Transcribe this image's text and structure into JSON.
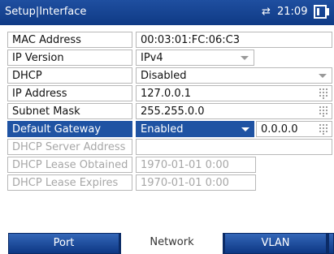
{
  "titlebar": {
    "title": "Setup|Interface",
    "network_icon": "network-arrows-icon",
    "time": "21:09",
    "battery_icon": "battery-icon"
  },
  "form": {
    "mac": {
      "label": "MAC Address",
      "value": "00:03:01:FC:06:C3"
    },
    "ipversion": {
      "label": "IP Version",
      "value": "IPv4"
    },
    "dhcp": {
      "label": "DHCP",
      "value": "Disabled"
    },
    "ip": {
      "label": "IP Address",
      "value": "127.0.0.1"
    },
    "subnet": {
      "label": "Subnet Mask",
      "value": "255.255.0.0"
    },
    "gateway": {
      "label": "Default Gateway",
      "value": "Enabled",
      "address": "0.0.0.0"
    },
    "dhcp_server": {
      "label": "DHCP Server Address",
      "value": ""
    },
    "lease_obtained": {
      "label": "DHCP Lease Obtained",
      "value": "1970-01-01 0:00"
    },
    "lease_expires": {
      "label": "DHCP Lease Expires",
      "value": "1970-01-01 0:00"
    }
  },
  "tabs": [
    {
      "label": "Port",
      "active": false
    },
    {
      "label": "Network",
      "active": true
    },
    {
      "label": "VLAN",
      "active": false
    }
  ],
  "colors": {
    "titlebar": "#1a4a9c",
    "selected": "#1f53a3",
    "tab": "#2a5cab"
  }
}
